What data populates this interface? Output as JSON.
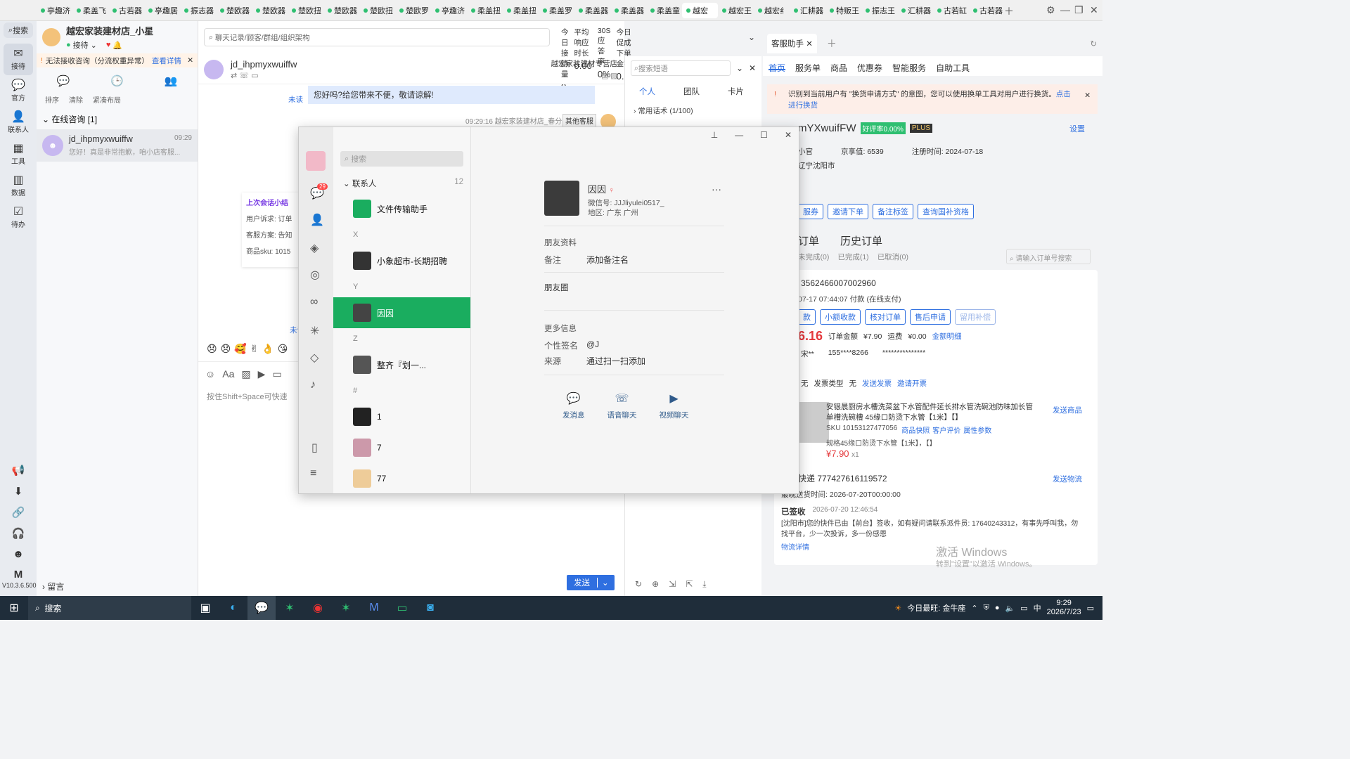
{
  "tabs": [
    {
      "label": "亭趣济"
    },
    {
      "label": "柔盖飞"
    },
    {
      "label": "古若器"
    },
    {
      "label": "亭趣居"
    },
    {
      "label": "振志器"
    },
    {
      "label": "楚欧器"
    },
    {
      "label": "楚欧器"
    },
    {
      "label": "楚欧扭"
    },
    {
      "label": "楚欧器"
    },
    {
      "label": "楚欧扭"
    },
    {
      "label": "楚欧罗"
    },
    {
      "label": "亭趣济"
    },
    {
      "label": "柔盖扭"
    },
    {
      "label": "柔盖扭"
    },
    {
      "label": "柔盖罗"
    },
    {
      "label": "柔盖器"
    },
    {
      "label": "柔盖器"
    },
    {
      "label": "柔盖童"
    },
    {
      "label": "越宏"
    },
    {
      "label": "越宏王"
    },
    {
      "label": "越宏纟"
    },
    {
      "label": "汇耕器"
    },
    {
      "label": "特贩王"
    },
    {
      "label": "振志王"
    },
    {
      "label": "汇耕器"
    },
    {
      "label": "古若缸"
    },
    {
      "label": "古若器"
    }
  ],
  "left_nav": {
    "search": "搜索",
    "items": [
      {
        "label": "接待",
        "icon": "chat-icon"
      },
      {
        "label": "官方",
        "icon": "message-icon"
      },
      {
        "label": "联系人",
        "icon": "person-icon"
      },
      {
        "label": "工具",
        "icon": "grid-icon"
      },
      {
        "label": "数据",
        "icon": "chart-icon"
      },
      {
        "label": "待办",
        "icon": "check-icon"
      }
    ],
    "version": "V10.3.6.500"
  },
  "conv": {
    "store_name": "越宏家装建材店_小星",
    "status": "接待",
    "warning": "无法接收咨询（分流权重异常）",
    "warning_link": "查看详情",
    "actions": [
      "排序",
      "清除",
      "紧凑布局"
    ],
    "group_label": "在线咨询 [1]",
    "item": {
      "name": "jd_ihpmyxwuiffw",
      "time": "09:29",
      "preview": "您好！真是非常抱歉，咱小店客服..."
    },
    "footer": "留言"
  },
  "chat": {
    "search_placeholder": "聊天记录/顾客/群组/组织架构",
    "stats": [
      {
        "label": "今日接待量",
        "value": "0"
      },
      {
        "label": "平均响应时长",
        "value": "0.00"
      },
      {
        "label": "30S应答率",
        "value": "0%"
      },
      {
        "label": "今日促成下单金额",
        "value": "0.00"
      }
    ],
    "contact": "jd_ihpmyxwuiffw",
    "store_tag": "越宏家装建材专营店",
    "unread": "未读",
    "message": "您好吗?给您带来不便，敬请谅解!",
    "meta": "09:29:16  越宏家装建材店_春分",
    "other_agent": "其他客服",
    "summary_title": "上次会话小结",
    "summary_lines": [
      "用户诉求: 订单",
      "客服方案: 告知",
      "商品sku: 1015"
    ],
    "unread2": "未读",
    "input_hint": "按住Shift+Space可快速",
    "send": "发送"
  },
  "info": {
    "search_placeholder": "搜索短语",
    "tabs": [
      "个人",
      "团队",
      "卡片"
    ],
    "common": "常用话术 (1/100)"
  },
  "kefu": {
    "title": "客服助手",
    "tabs": [
      "首页",
      "服务单",
      "商品",
      "优惠券",
      "智能服务",
      "自助工具"
    ],
    "alert": "识别到当前用户有 \"换货申请方式\" 的意图，您可以使用换单工具对用户进行换货。",
    "alert_link": "点击进行换货",
    "user": "mYXwuifFW",
    "good_rate": "好评率0.00%",
    "plus": "PLUS",
    "settings": "设置",
    "level": "小官",
    "jingxiang_label": "京享值:",
    "jingxiang": "6539",
    "reg_label": "注册时间:",
    "reg": "2024-07-18",
    "location": "辽宁沈阳市",
    "buttons": [
      "服券",
      "邀请下单",
      "备注标签",
      "查询国补资格"
    ],
    "order_tabs": [
      "订单",
      "历史订单"
    ],
    "order_filters": [
      "未完成(0)",
      "已完成(1)",
      "已取消(0)"
    ],
    "order_search": "请输入订单号搜索",
    "order_id": "3562466007002960",
    "order_time": "07-17 07:44:07",
    "pay": "付款 (在线支付)",
    "order_btns": [
      "款",
      "小额收款",
      "核对订单",
      "售后申请",
      "留用补偿"
    ],
    "price": "6.16",
    "order_amount_label": "订单金额",
    "order_amount": "¥7.90",
    "freight_label": "运费",
    "freight": "¥0.00",
    "detail": "金额明细",
    "buyer": "宋**",
    "phone": "155****8266",
    "masked": "***************",
    "invoice_label": "发票类型",
    "invoice": "无",
    "none": "无",
    "send_invoice": "发送发票",
    "invite_invoice": "邀请开票",
    "product": "安银晨厨房水槽洗菜盆下水管配件延长排水管洗碗池防味加长管单槽洗碗槽 45缘口防烫下水管【1米】【】",
    "send_product": "发送商品",
    "sku": "SKU 10153127477056",
    "links": [
      "商品快照",
      "客户评价",
      "属性参数"
    ],
    "spec": "规格45缘口防烫下水管【1米】，【】",
    "product_price": "¥7.90",
    "qty": "x1",
    "express": "快递 777427616119572",
    "send_logistics": "发送物流",
    "deliver": "最晚送货时间: 2026-07-20T00:00:00",
    "signed": "已签收",
    "signed_time": "2026-07-20 12:46:54",
    "logistics_text": "[沈阳市]您的快件已由【前台】签收，如有疑问请联系派件员: 17640243312，有事先呼叫我，勿找平台，少一次投诉，多一份感恩",
    "logistics_detail": "物流详情",
    "watermark1": "激活 Windows",
    "watermark2": "转到\"设置\"以激活 Windows。"
  },
  "wechat": {
    "search": "搜索",
    "badge": "29",
    "contacts_header": "联系人",
    "contacts_count": "12",
    "groups": [
      {
        "letter": "",
        "items": [
          {
            "name": "文件传输助手",
            "color": "#1aad5f"
          }
        ]
      },
      {
        "letter": "X",
        "items": [
          {
            "name": "小象超市-长期招聘",
            "color": "#333"
          }
        ]
      },
      {
        "letter": "Y",
        "items": [
          {
            "name": "因因",
            "color": "#444"
          }
        ]
      },
      {
        "letter": "Z",
        "items": [
          {
            "name": "整齐『划一...",
            "color": "#555"
          }
        ]
      },
      {
        "letter": "#",
        "items": [
          {
            "name": "1",
            "color": "#222"
          },
          {
            "name": "7",
            "color": "#c9a"
          },
          {
            "name": "77",
            "color": "#ec9"
          }
        ]
      }
    ],
    "profile": {
      "name": "因因",
      "wxid": "微信号: JJJliyulei0517_",
      "region": "地区: 广东 广州",
      "section1": "朋友资料",
      "remark_k": "备注",
      "remark_v": "添加备注名",
      "moments": "朋友圈",
      "more": "更多信息",
      "sig_k": "个性签名",
      "sig_v": "@J",
      "source_k": "来源",
      "source_v": "通过扫一扫添加",
      "actions": [
        "发消息",
        "语音聊天",
        "视频聊天"
      ]
    }
  },
  "taskbar": {
    "search": "搜索",
    "weather": "今日最旺: 金牛座",
    "time": "9:29",
    "date": "2026/7/23",
    "ime": "中"
  }
}
